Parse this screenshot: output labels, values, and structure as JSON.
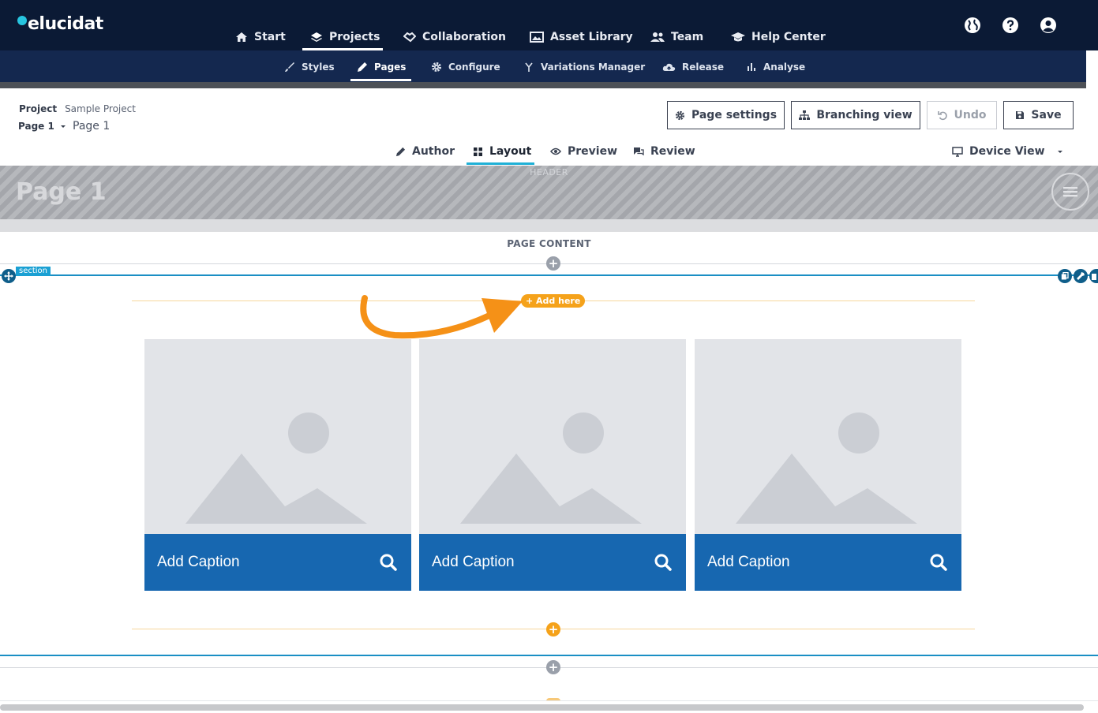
{
  "app": {
    "logo": "elucidat"
  },
  "top_nav": {
    "items": [
      {
        "label": "Start",
        "icon": "home-icon"
      },
      {
        "label": "Projects",
        "icon": "layers-icon",
        "active": true
      },
      {
        "label": "Collaboration",
        "icon": "handshake-icon"
      },
      {
        "label": "Asset Library",
        "icon": "images-icon"
      },
      {
        "label": "Team",
        "icon": "users-icon"
      },
      {
        "label": "Help Center",
        "icon": "graduation-cap-icon"
      }
    ],
    "right_icons": [
      "globe-icon",
      "help-icon",
      "user-icon"
    ]
  },
  "sub_nav": {
    "items": [
      {
        "label": "Styles",
        "icon": "brush-icon"
      },
      {
        "label": "Pages",
        "icon": "pencil-icon",
        "active": true
      },
      {
        "label": "Configure",
        "icon": "gear-icon"
      },
      {
        "label": "Variations Manager",
        "icon": "branch-icon"
      },
      {
        "label": "Release",
        "icon": "cloud-upload-icon"
      },
      {
        "label": "Analyse",
        "icon": "bar-chart-icon"
      }
    ]
  },
  "project": {
    "project_label": "Project",
    "project_name": "Sample Project",
    "page_selector": "Page 1",
    "page_name": "Page 1"
  },
  "toolbar": {
    "page_settings": "Page settings",
    "branching_view": "Branching view",
    "undo": "Undo",
    "save": "Save"
  },
  "mode_tabs": {
    "author": "Author",
    "layout": "Layout",
    "preview": "Preview",
    "review": "Review",
    "device_view": "Device View"
  },
  "canvas": {
    "header_label": "HEADER",
    "page_title": "Page 1",
    "page_content_label": "PAGE CONTENT",
    "section_tag": "section",
    "add_here": "+ Add here",
    "cards": [
      {
        "caption": "Add Caption"
      },
      {
        "caption": "Add Caption"
      },
      {
        "caption": "Add Caption"
      }
    ]
  },
  "colors": {
    "top_nav_bg": "#0b1a35",
    "sub_nav_bg": "#14284f",
    "accent_blue": "#1767b0",
    "accent_orange": "#f5a21a",
    "section_blue": "#1aa0d3"
  }
}
